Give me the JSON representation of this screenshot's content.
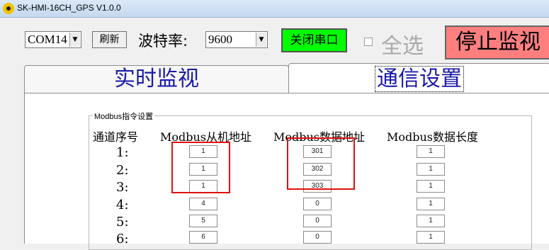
{
  "window": {
    "title": "SK-HMI-16CH_GPS V1.0.0"
  },
  "toolbar": {
    "port_value": "COM14",
    "refresh_label": "刷新",
    "baud_label": "波特率:",
    "baud_value": "9600",
    "close_port_label": "关闭串口",
    "select_all_label": "全选",
    "stop_monitor_label": "停止监视",
    "colors": {
      "close_port_bg": "#00ff00",
      "stop_monitor_bg": "#ff7f7f",
      "highlight": "#e01010"
    }
  },
  "tabs": [
    {
      "label": "实时监视",
      "active": false
    },
    {
      "label": "通信设置",
      "active": true
    }
  ],
  "modbus_group": {
    "legend": "Modbus指令设置",
    "headers": {
      "channel": "通道序号",
      "slave_addr": "Modbus从机地址",
      "data_addr": "Modbus数据地址",
      "data_len": "Modbus数据长度"
    },
    "rows": [
      {
        "label": "1:",
        "slave": "1",
        "addr": "301",
        "len": "1"
      },
      {
        "label": "2:",
        "slave": "1",
        "addr": "302",
        "len": "1"
      },
      {
        "label": "3:",
        "slave": "1",
        "addr": "303",
        "len": "1"
      },
      {
        "label": "4:",
        "slave": "4",
        "addr": "0",
        "len": "1"
      },
      {
        "label": "5:",
        "slave": "5",
        "addr": "0",
        "len": "1"
      },
      {
        "label": "6:",
        "slave": "6",
        "addr": "0",
        "len": "1"
      }
    ]
  }
}
